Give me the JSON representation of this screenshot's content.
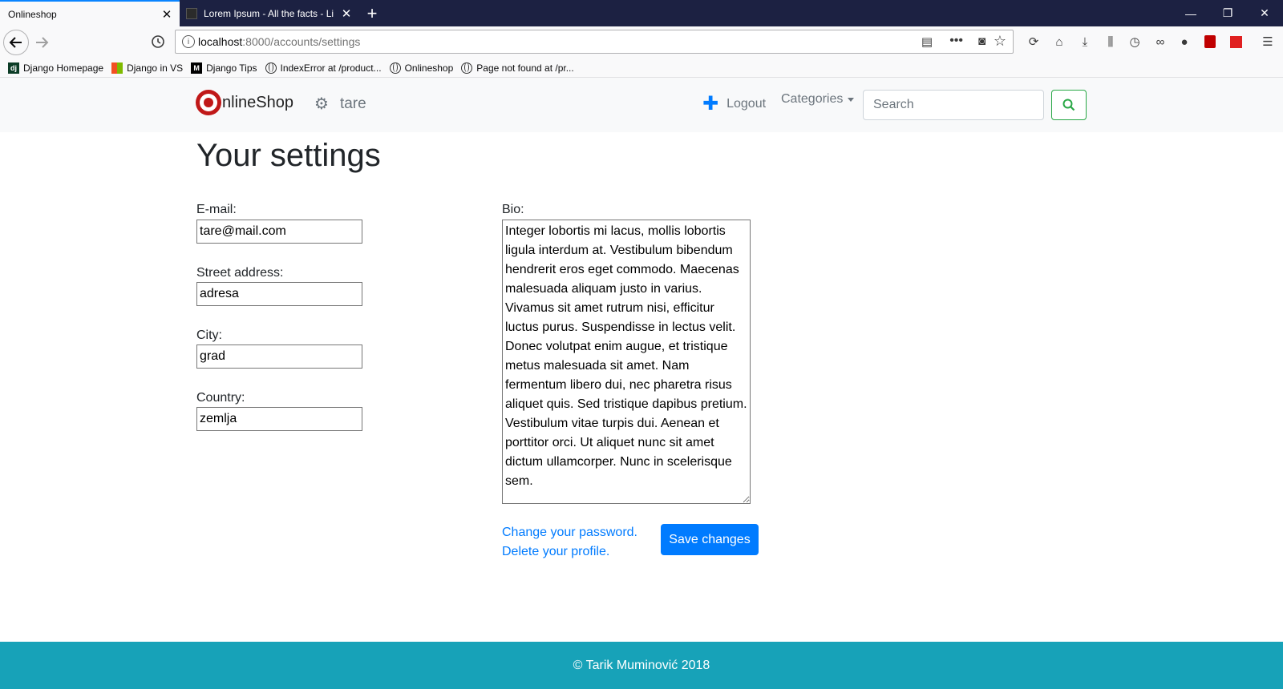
{
  "browser": {
    "tabs": [
      {
        "title": "Onlineshop",
        "active": true
      },
      {
        "title": "Lorem Ipsum - All the facts - Li",
        "active": false
      }
    ],
    "new_tab": "+",
    "url": {
      "host": "localhost",
      "path": ":8000/accounts/settings"
    },
    "bookmarks": [
      {
        "label": "Django Homepage",
        "icon": "django-icon"
      },
      {
        "label": "Django in VS",
        "icon": "windows-icon"
      },
      {
        "label": "Django Tips",
        "icon": "medium-icon"
      },
      {
        "label": "IndexError at /product...",
        "icon": "globe-icon"
      },
      {
        "label": "Onlineshop",
        "icon": "globe-icon"
      },
      {
        "label": "Page not found at /pr...",
        "icon": "globe-icon"
      }
    ]
  },
  "site": {
    "brand": "nlineShop",
    "username": "tare",
    "nav": {
      "logout": "Logout",
      "categories": "Categories"
    },
    "search": {
      "placeholder": "Search",
      "value": ""
    },
    "accent_color": "#007bff",
    "footer_color": "#17a2b8"
  },
  "page": {
    "title": "Your settings",
    "fields": {
      "email": {
        "label": "E-mail:",
        "value": "tare@mail.com"
      },
      "street": {
        "label": "Street address:",
        "value": "adresa"
      },
      "city": {
        "label": "City:",
        "value": "grad"
      },
      "country": {
        "label": "Country:",
        "value": "zemlja"
      },
      "bio": {
        "label": "Bio:",
        "value": "Integer lobortis mi lacus, mollis lobortis ligula interdum at. Vestibulum bibendum hendrerit eros eget commodo. Maecenas malesuada aliquam justo in varius. Vivamus sit amet rutrum nisi, efficitur luctus purus. Suspendisse in lectus velit. Donec volutpat enim augue, et tristique metus malesuada sit amet. Nam fermentum libero dui, nec pharetra risus aliquet quis. Sed tristique dapibus pretium. Vestibulum vitae turpis dui. Aenean et porttitor orci. Ut aliquet nunc sit amet dictum ullamcorper. Nunc in scelerisque sem."
      }
    },
    "change_password": "Change your password.",
    "delete_profile": "Delete your profile.",
    "save": "Save changes"
  },
  "footer": {
    "text": "© Tarik Muminović 2018"
  }
}
